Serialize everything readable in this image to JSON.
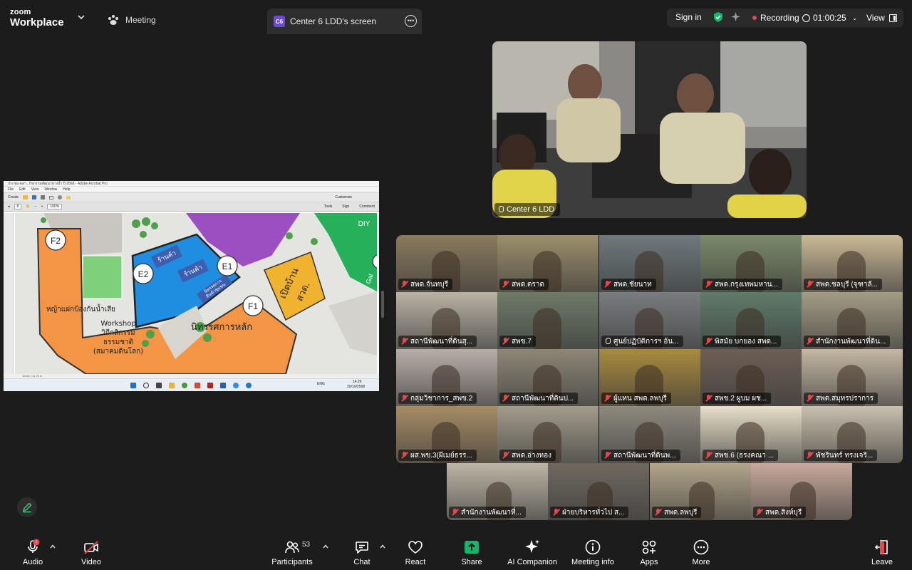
{
  "app": {
    "brand_top": "zoom",
    "brand_bottom": "Workplace",
    "meeting_label": "Meeting"
  },
  "tab": {
    "badge": "C6",
    "title": "Center 6 LDD's screen"
  },
  "status": {
    "sign_in": "Sign in",
    "recording": "Recording",
    "timer": "01:00:25",
    "view": "View"
  },
  "shared_screen": {
    "window_title": "ประชุม-ผลฯ...กิจกรรมพัฒนาทางน้ำ ปี 2568 - Adobe Acrobat Pro",
    "menu": [
      "File",
      "Edit",
      "View",
      "Window",
      "Help"
    ],
    "create": "Create",
    "customize": "Customize",
    "page": "8",
    "zoom": "100%",
    "panels": [
      "Tools",
      "Sign",
      "Comment"
    ],
    "status_size": "16.53 x 11.70 in",
    "tray_lang": "ENG",
    "tray_time": "14:26",
    "tray_date": "20/10/2568",
    "map": {
      "labels": {
        "f2": "F2",
        "e2": "E2",
        "e1": "E1",
        "f1": "F1",
        "diy": "DIY",
        "gal": "Gal",
        "shop1": "ร้านค้า",
        "shop2": "ร้านค้า",
        "booth1": "นิทรรศการ",
        "booth2": "สินค้าชุมชน",
        "grass": "หญ้าแฝกป้องกันน้ำเสีย",
        "workshop1": "Workshop",
        "workshop2": "วิถีกสิกรรม",
        "workshop3": "ธรรมชาติ",
        "workshop4": "(สมาคมดินโลก)",
        "main_exhibit": "นิทรรศการหลัก",
        "open1": "เปิดบ้าน",
        "open2": "สวด."
      }
    }
  },
  "speaker": {
    "name": "Center 6 LDD"
  },
  "gallery": [
    {
      "name": "สพด.จันทบุรี",
      "muted": true,
      "bg": "#8a7a5e"
    },
    {
      "name": "สพด.ตราด",
      "muted": true,
      "bg": "#9d8f6c"
    },
    {
      "name": "สพด.ชัยนาท",
      "muted": true,
      "bg": "#6f7a7c"
    },
    {
      "name": "สพด.กรุงเทพมหาน...",
      "muted": true,
      "bg": "#7b8a6a"
    },
    {
      "name": "สพด.ชลบุรี (จุฑาลั...",
      "muted": true,
      "bg": "#c9b996"
    },
    {
      "name": "สถานีพัฒนาที่ดินสุ...",
      "muted": true,
      "bg": "#b9b3a4"
    },
    {
      "name": "สพข.7",
      "muted": true,
      "bg": "#6e7a68"
    },
    {
      "name": "ศูนย์ปฏิบัติการฯ อ้น...",
      "muted": false,
      "bg": "#7a7d80"
    },
    {
      "name": "พิสมัย บกยอง สพด...",
      "muted": true,
      "bg": "#5f7b6a"
    },
    {
      "name": "สำนักงานพัฒนาที่ดิน...",
      "muted": true,
      "bg": "#a39c84"
    },
    {
      "name": "กลุ่มวิชาการ_สพข.2",
      "muted": true,
      "bg": "#b8aea8"
    },
    {
      "name": "สถานีพัฒนาที่ดินป...",
      "muted": true,
      "bg": "#8d8777"
    },
    {
      "name": "ผู้แทน สพด.ลพบุรี",
      "muted": true,
      "bg": "#a98a3f"
    },
    {
      "name": "สพข.2 ผูบม ผช...",
      "muted": true,
      "bg": "#6d5f55"
    },
    {
      "name": "สพด.สมุทรปราการ",
      "muted": true,
      "bg": "#c4b7a4"
    },
    {
      "name": "ผส.พข.3(ผีเมย์ธรร...",
      "muted": true,
      "bg": "#a58c64"
    },
    {
      "name": "สพด.อ่างทอง",
      "muted": true,
      "bg": "#a29c8b"
    },
    {
      "name": "สถานีพัฒนาที่ดินพ...",
      "muted": true,
      "bg": "#8e8a7e"
    },
    {
      "name": "สพข.6 (ธรงคณา ...",
      "muted": true,
      "bg": "#e7dfc9"
    },
    {
      "name": "พัชรินทร์ ทรงเจริ...",
      "muted": true,
      "bg": "#c9c0ae"
    }
  ],
  "gallery_bottom": [
    {
      "name": "สำนักงานพัฒนาที่...",
      "muted": true,
      "bg": "#bdb6a6"
    },
    {
      "name": "ฝ่ายบริหารทั่วไป ส...",
      "muted": true,
      "bg": "#6e685f"
    },
    {
      "name": "สพด.ลพบุรี",
      "muted": true,
      "bg": "#b2a58a"
    },
    {
      "name": "สพด.สิงห์บุรี",
      "muted": true,
      "bg": "#c8a99c"
    }
  ],
  "toolbar": {
    "audio": "Audio",
    "video": "Video",
    "participants": "Participants",
    "participant_count": "53",
    "chat": "Chat",
    "react": "React",
    "share": "Share",
    "ai_companion": "AI Companion",
    "meeting_info": "Meeting info",
    "apps": "Apps",
    "more": "More",
    "leave": "Leave",
    "mic_badge": "!"
  },
  "colors": {
    "accent_green": "#12b76a",
    "record_red": "#e5484d",
    "leave_red": "#e5484d",
    "badge_purple": "#6e4bd6"
  }
}
